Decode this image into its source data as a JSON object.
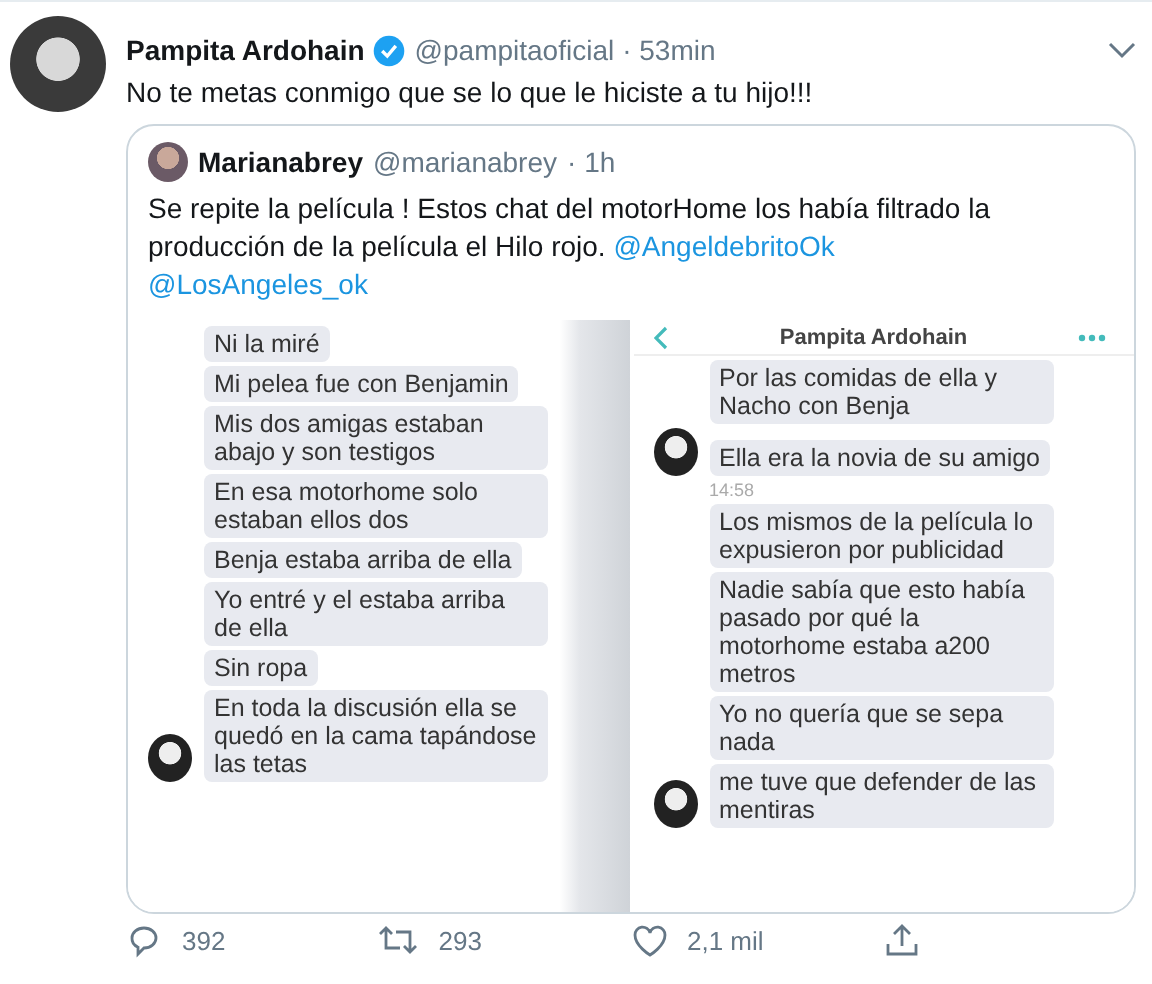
{
  "tweet": {
    "author": {
      "name": "Pampita Ardohain",
      "verified": true,
      "handle": "@pampitaoficial",
      "time": "· 53min"
    },
    "text": "No te metas conmigo que se lo que le hiciste a tu hijo!!!",
    "quote": {
      "author": {
        "name": "Marianabrey",
        "handle": "@marianabrey",
        "time": "· 1h"
      },
      "segments": [
        {
          "kind": "text",
          "text": "Se repite la película ! Estos chat del motorHome los había filtrado la producción de la película el Hilo rojo. "
        },
        {
          "kind": "mention",
          "text": "@AngeldebritoOk"
        },
        {
          "kind": "mention",
          "text": "@LosAngeles_ok"
        }
      ],
      "images": [
        {
          "messages": [
            {
              "kind": "bubble",
              "text": "Ni la miré",
              "avatar": false
            },
            {
              "kind": "bubble",
              "text": "Mi pelea fue con Benjamin",
              "avatar": false
            },
            {
              "kind": "bubble",
              "text": "Mis dos amigas estaban abajo y son testigos",
              "avatar": false
            },
            {
              "kind": "bubble",
              "text": "En esa motorhome solo estaban ellos dos",
              "avatar": false
            },
            {
              "kind": "bubble",
              "text": "Benja estaba arriba de ella",
              "avatar": false
            },
            {
              "kind": "bubble",
              "text": "Yo entré y el estaba arriba de ella",
              "avatar": false
            },
            {
              "kind": "bubble",
              "text": "Sin ropa",
              "avatar": false
            },
            {
              "kind": "bubble",
              "text": "En toda la discusión ella se quedó en la cama tapándose las tetas",
              "avatar": true
            }
          ]
        },
        {
          "header": {
            "title": "Pampita Ardohain"
          },
          "messages": [
            {
              "kind": "bubble",
              "text": "Por las comidas de ella y Nacho con Benja",
              "avatar": false
            },
            {
              "kind": "bubble",
              "text": "Ella era la novia de su amigo",
              "avatar": true
            },
            {
              "kind": "time",
              "text": "14:58"
            },
            {
              "kind": "bubble",
              "text": "Los mismos de la película lo expusieron por publicidad",
              "avatar": false
            },
            {
              "kind": "bubble",
              "text": "Nadie sabía que esto había pasado por qué la motorhome estaba a200 metros",
              "avatar": false
            },
            {
              "kind": "bubble",
              "text": "Yo no quería que se sepa nada",
              "avatar": false
            },
            {
              "kind": "bubble",
              "text": "me tuve que defender de las mentiras",
              "avatar": true
            }
          ]
        }
      ]
    },
    "actions": [
      {
        "kind": "reply",
        "count": "392"
      },
      {
        "kind": "retweet",
        "count": "293"
      },
      {
        "kind": "like",
        "count": "2,1 mil"
      },
      {
        "kind": "share"
      }
    ]
  }
}
